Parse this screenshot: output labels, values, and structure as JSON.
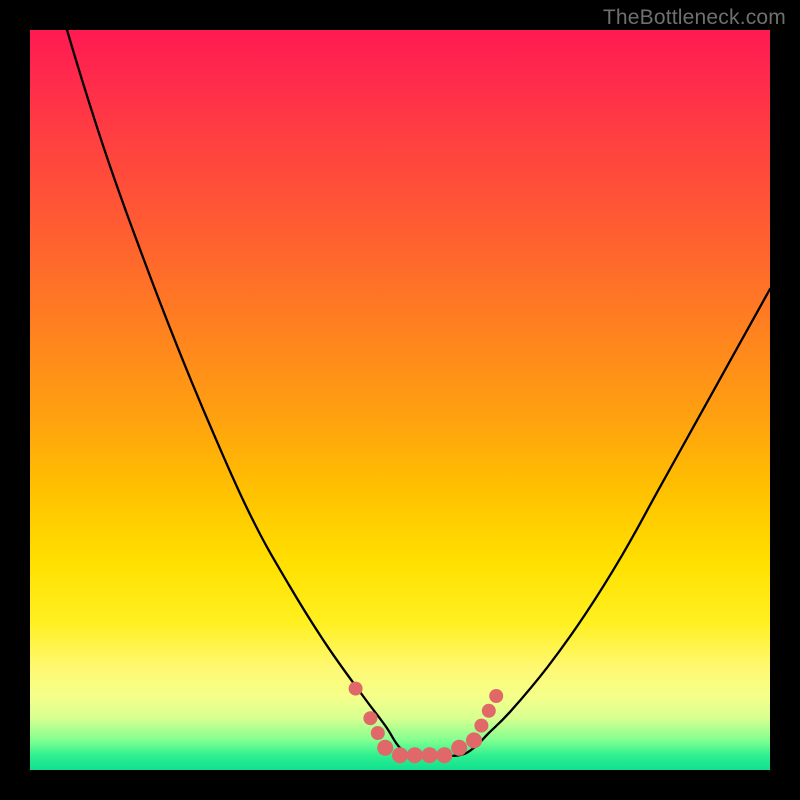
{
  "watermark": {
    "text": "TheBottleneck.com"
  },
  "colors": {
    "frame": "#000000",
    "curve_stroke": "#000000",
    "marker_fill": "#e06868",
    "marker_stroke": "#c85858",
    "gradient_stops": [
      "#ff1a52",
      "#ff8020",
      "#ffe000",
      "#fff870",
      "#10e090"
    ]
  },
  "chart_data": {
    "type": "line",
    "title": "",
    "xlabel": "",
    "ylabel": "",
    "xlim": [
      0,
      100
    ],
    "ylim": [
      0,
      100
    ],
    "grid": false,
    "legend": false,
    "note": "Axis values are inferred normalized percentages; y = bottleneck %, minimum at the trough. Curve y-values read off vertical position (0 = bottom/no bottleneck, 100 = top).",
    "series": [
      {
        "name": "bottleneck-curve",
        "x": [
          0,
          5,
          10,
          15,
          20,
          25,
          30,
          35,
          40,
          45,
          48,
          50,
          52,
          55,
          58,
          60,
          62,
          65,
          70,
          75,
          80,
          85,
          90,
          95,
          100
        ],
        "y": [
          118,
          100,
          84,
          70,
          57,
          45,
          34,
          25,
          17,
          10,
          6,
          3,
          2,
          2,
          2,
          3,
          5,
          8,
          14,
          21,
          29,
          38,
          47,
          56,
          65
        ]
      }
    ],
    "markers": {
      "name": "trough-dots",
      "x": [
        44,
        46,
        47,
        48,
        50,
        52,
        54,
        56,
        58,
        60,
        61,
        62,
        63
      ],
      "y": [
        11,
        7,
        5,
        3,
        2,
        2,
        2,
        2,
        3,
        4,
        6,
        8,
        10
      ]
    }
  }
}
